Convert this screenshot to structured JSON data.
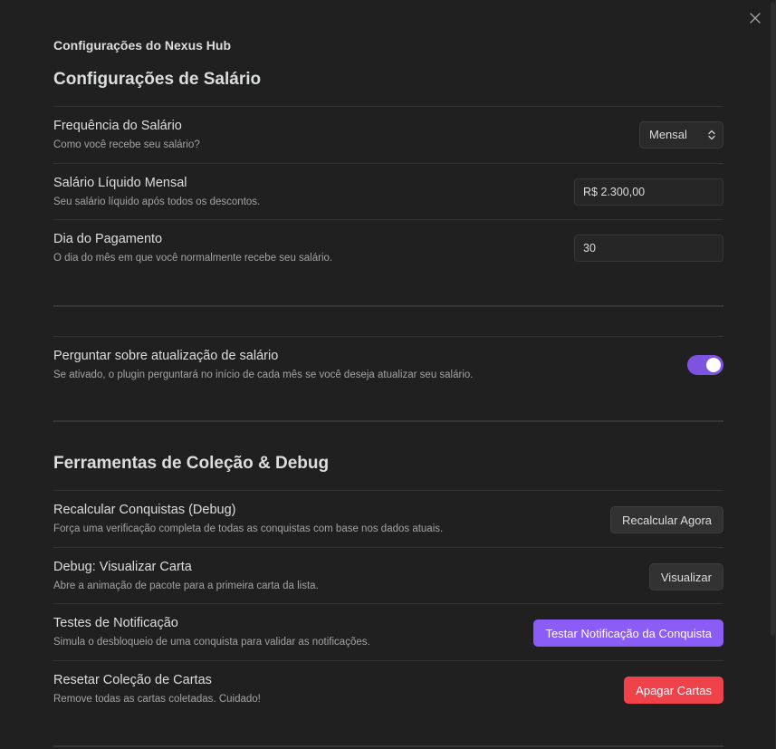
{
  "window": {
    "title": "Configurações do Nexus Hub"
  },
  "salary_section": {
    "heading": "Configurações de Salário",
    "frequency": {
      "name": "Frequência do Salário",
      "desc": "Como você recebe seu salário?",
      "selected": "Mensal"
    },
    "net_salary": {
      "name": "Salário Líquido Mensal",
      "desc": "Seu salário líquido após todos os descontos.",
      "value": "R$ 2.300,00"
    },
    "pay_day": {
      "name": "Dia do Pagamento",
      "desc": "O dia do mês em que você normalmente recebe seu salário.",
      "value": "30"
    }
  },
  "update_prompt": {
    "name": "Perguntar sobre atualização de salário",
    "desc": "Se ativado, o plugin perguntará no início de cada mês se você deseja atualizar seu salário.",
    "enabled": true
  },
  "tools_section": {
    "heading": "Ferramentas de Coleção & Debug",
    "recalc": {
      "name": "Recalcular Conquistas (Debug)",
      "desc": "Força uma verificação completa de todas as conquistas com base nos dados atuais.",
      "button": "Recalcular Agora"
    },
    "view_card": {
      "name": "Debug: Visualizar Carta",
      "desc": "Abre a animação de pacote para a primeira carta da lista.",
      "button": "Visualizar"
    },
    "notification": {
      "name": "Testes de Notificação",
      "desc": "Simula o desbloqueio de uma conquista para validar as notificações.",
      "button": "Testar Notificação da Conquista"
    },
    "reset": {
      "name": "Resetar Coleção de Cartas",
      "desc": "Remove todas as cartas coletadas. Cuidado!",
      "button": "Apagar Cartas"
    }
  },
  "colors": {
    "accent": "#8b5cf6",
    "danger": "#f0424a",
    "toggle_on": "#7c54e0"
  },
  "icons": {
    "close": "close-icon",
    "select_chevron": "chevron-updown-icon"
  }
}
